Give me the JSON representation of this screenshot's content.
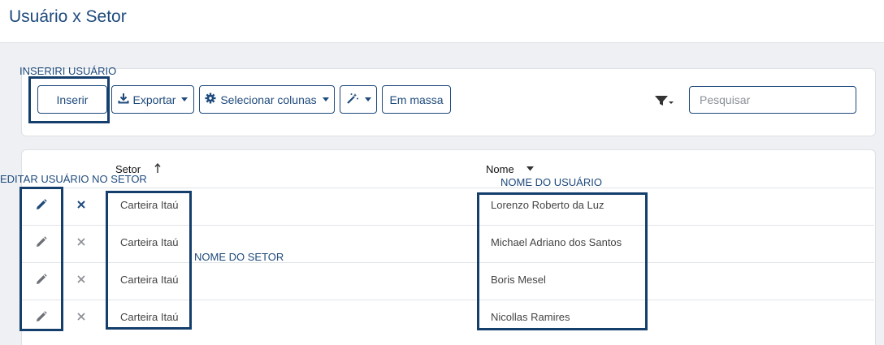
{
  "header": {
    "title": "Usuário x Setor"
  },
  "toolbar": {
    "insert_label": "Inserir",
    "export_label": "Exportar",
    "columns_label": "Selecionar colunas",
    "bulk_label": "Em massa",
    "search_placeholder": "Pesquisar"
  },
  "table": {
    "columns": [
      "Setor",
      "Nome"
    ],
    "rows": [
      {
        "setor": "Carteira Itaú",
        "nome": "Lorenzo Roberto da Luz"
      },
      {
        "setor": "Carteira Itaú",
        "nome": "Michael Adriano dos Santos"
      },
      {
        "setor": "Carteira Itaú",
        "nome": "Boris Mesel"
      },
      {
        "setor": "Carteira Itaú",
        "nome": "Nicollas Ramires"
      }
    ]
  },
  "annotations": {
    "insert": "INSERIRI USUÁRIO",
    "edit": "EDITAR USUÁRIO NO SETOR",
    "sector": "NOME DO SETOR",
    "user": "NOME DO USUÁRIO"
  },
  "icons": {
    "export": "download-icon",
    "columns": "gear-icon",
    "magic": "magic-wand-icon",
    "filter": "filter-icon",
    "edit": "pencil-icon",
    "delete": "close-icon",
    "sort_asc": "arrow-up-icon",
    "sort_desc": "caret-down-icon"
  },
  "colors": {
    "primary": "#1e4a7c",
    "annotation": "#143e6b"
  }
}
